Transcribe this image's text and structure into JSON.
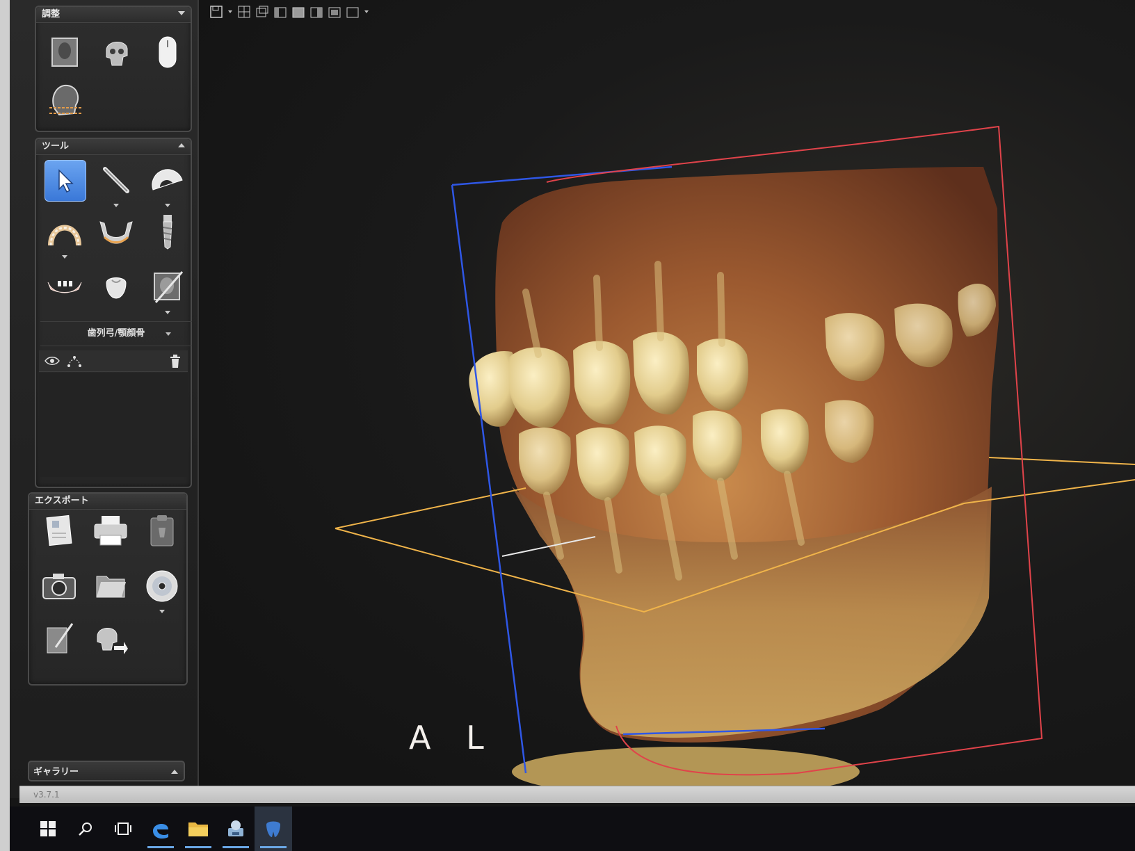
{
  "panels": {
    "adjust": {
      "title": "調整"
    },
    "tools": {
      "title": "ツール",
      "dropdown_label": "歯列弓/顎顔骨"
    },
    "export": {
      "title": "エクスポート"
    },
    "gallery": {
      "title": "ギャラリー"
    }
  },
  "viewport": {
    "orientation_label": "A L"
  },
  "status": {
    "version": "v3.7.1"
  },
  "colors": {
    "selected_tool": "#3a78d8",
    "sagittal_plane": "#e0434a",
    "coronal_plane": "#2f57e6",
    "axial_plane": "#f0b44a",
    "bone_tint": "#d9b870"
  }
}
